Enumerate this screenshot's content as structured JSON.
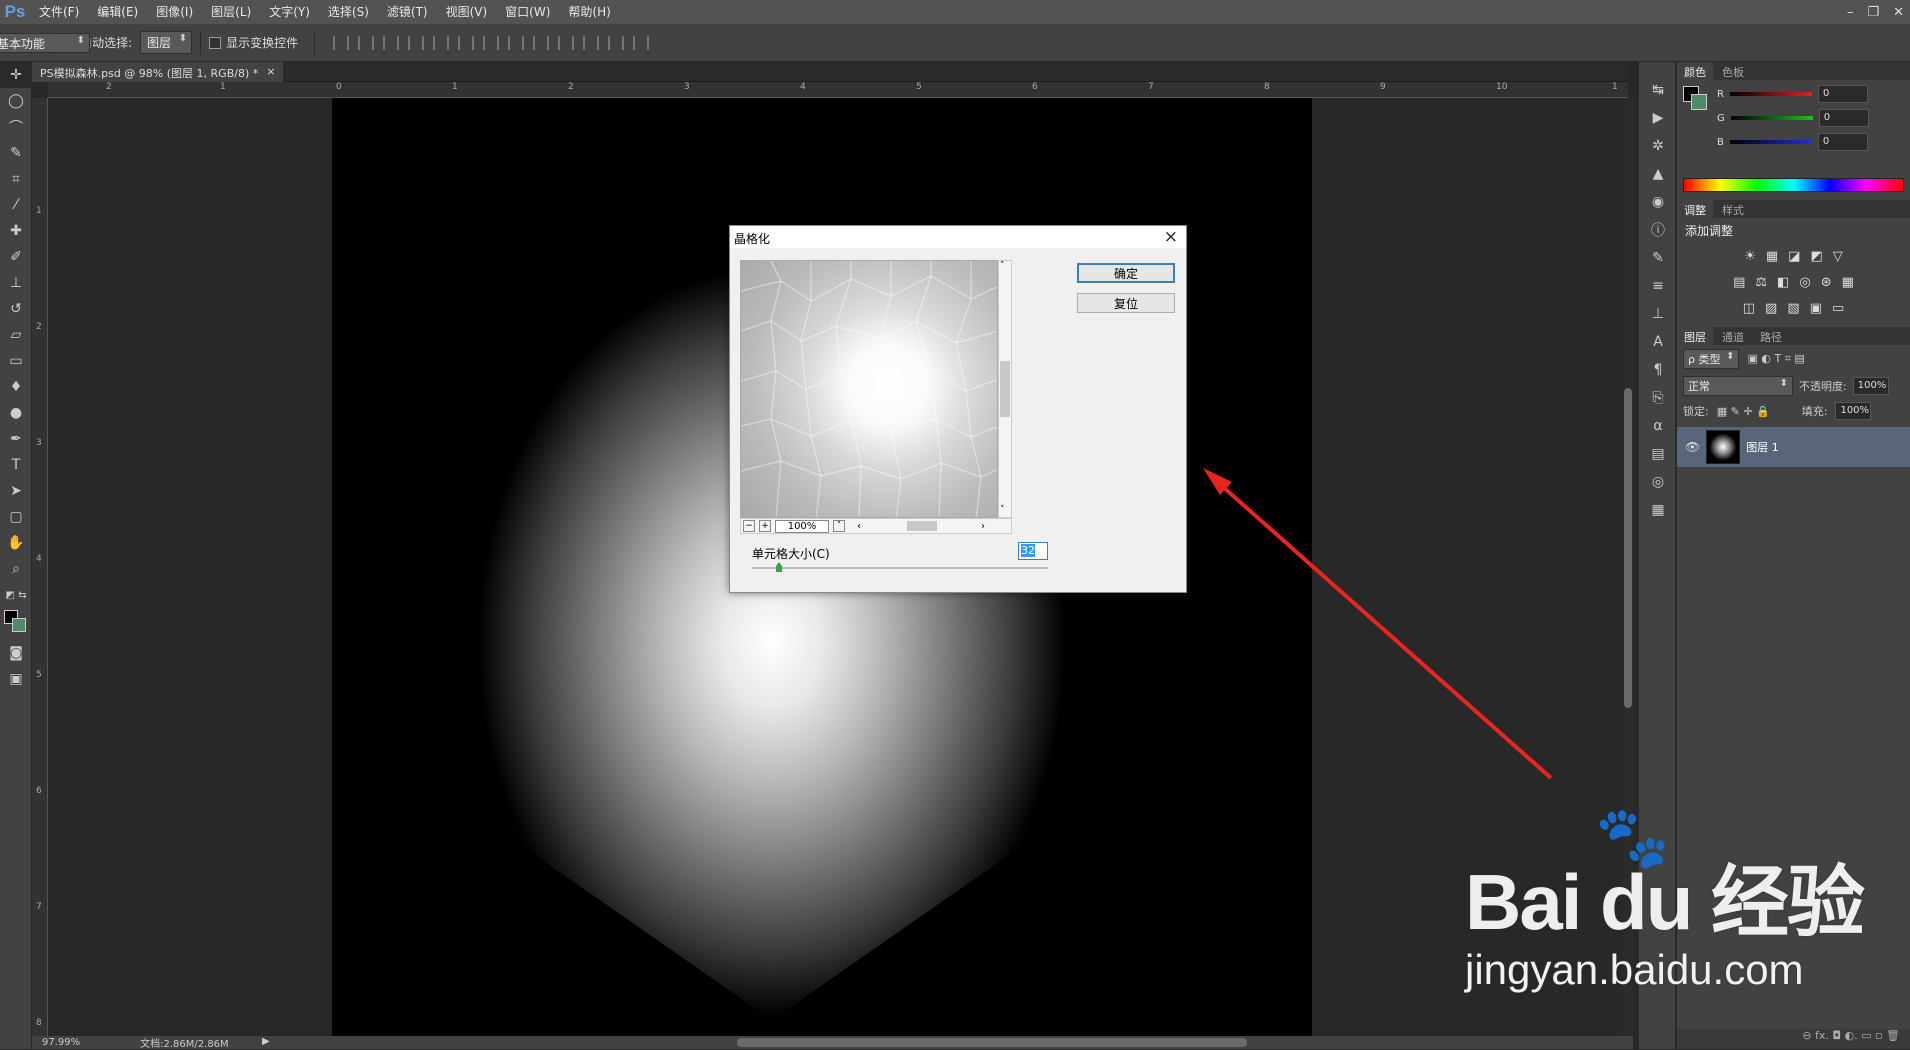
{
  "app": {
    "logo": "Ps"
  },
  "menu": [
    "文件(F)",
    "编辑(E)",
    "图像(I)",
    "图层(L)",
    "文字(Y)",
    "选择(S)",
    "滤镜(T)",
    "视图(V)",
    "窗口(W)",
    "帮助(H)"
  ],
  "window_controls": {
    "min": "–",
    "restore": "❐",
    "close": "✕"
  },
  "options": {
    "auto_select_label": "自动选择:",
    "auto_select_value": "图层",
    "show_transform_label": "显示变换控件",
    "workspace": "基本功能"
  },
  "document": {
    "tab_title": "PS模拟森林.psd @ 98% (图层 1, RGB/8) *",
    "tab_close": "×",
    "zoom": "97.99%",
    "doc_info": "文档:2.86M/2.86M"
  },
  "ruler_h": [
    "2",
    "1",
    "0",
    "1",
    "2",
    "3",
    "4",
    "5",
    "6",
    "7",
    "8",
    "9",
    "10",
    "1"
  ],
  "ruler_v": [
    "1",
    "2",
    "3",
    "4",
    "5",
    "6",
    "7",
    "8"
  ],
  "color_panel": {
    "tabs": [
      "颜色",
      "色板"
    ],
    "channels": [
      {
        "label": "R",
        "value": "0",
        "color": "#e02020"
      },
      {
        "label": "G",
        "value": "0",
        "color": "#20c020"
      },
      {
        "label": "B",
        "value": "0",
        "color": "#2030e0"
      }
    ]
  },
  "adjust_panel": {
    "tabs": [
      "调整",
      "样式"
    ],
    "title": "添加调整"
  },
  "layers_panel": {
    "tabs": [
      "图层",
      "通道",
      "路径"
    ],
    "kind_label": "ρ 类型",
    "blend_mode": "正常",
    "opacity_label": "不透明度:",
    "opacity_value": "100%",
    "lock_label": "锁定:",
    "fill_label": "填充:",
    "fill_value": "100%",
    "layer_name": "图层 1",
    "bottom_icons": "⊖ fx. ◘ ◐. ▭ ▫ 🗑"
  },
  "dialog": {
    "title": "晶格化",
    "ok": "确定",
    "reset": "复位",
    "zoom": "100%",
    "cell_size_label": "单元格大小(C)",
    "cell_size_value": "32"
  },
  "watermark": {
    "brand": "Bai du 经验",
    "url": "jingyan.baidu.com"
  }
}
